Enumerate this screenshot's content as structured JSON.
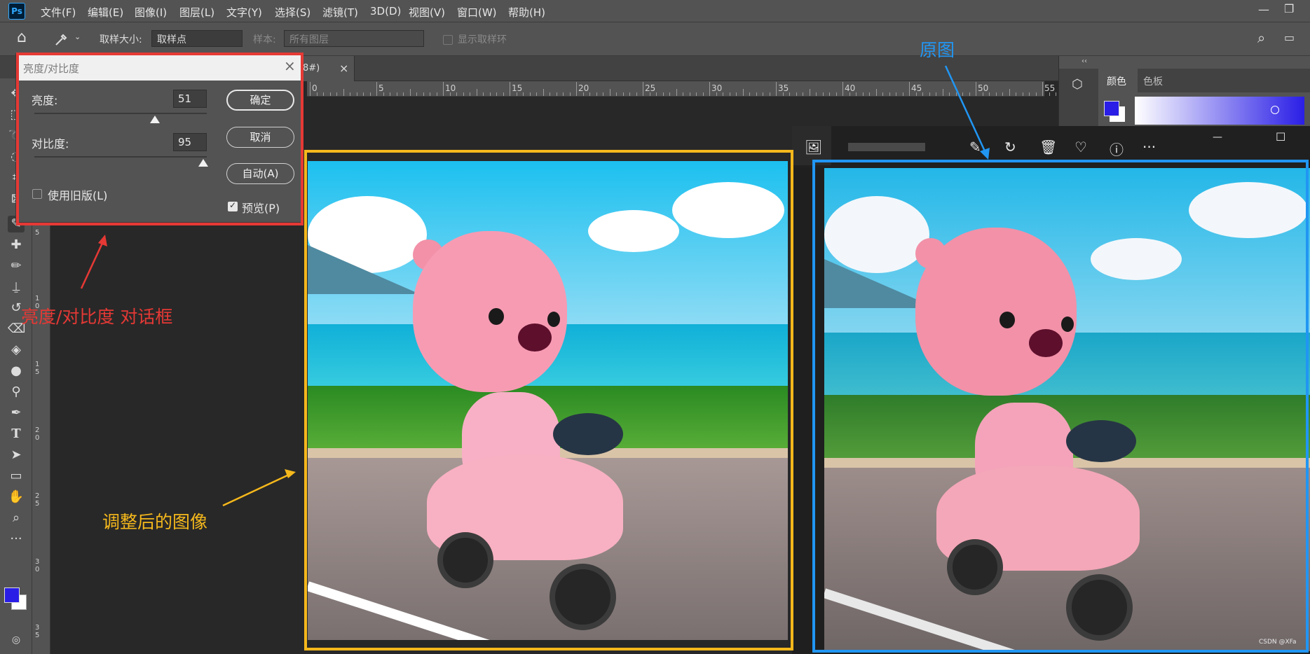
{
  "app": {
    "logo": "Ps"
  },
  "menu": [
    "文件(F)",
    "编辑(E)",
    "图像(I)",
    "图层(L)",
    "文字(Y)",
    "选择(S)",
    "滤镜(T)",
    "3D(D)",
    "视图(V)",
    "窗口(W)",
    "帮助(H)"
  ],
  "options": {
    "sample_size_label": "取样大小:",
    "sample_size_value": "取样点",
    "sample_label": "样本:",
    "sample_value": "所有图层",
    "show_ring_label": "显示取样环"
  },
  "doc_tab": {
    "title_fragment": "8#)",
    "close": "×"
  },
  "ruler_top": [
    "0",
    "5",
    "10",
    "15",
    "20",
    "25",
    "30",
    "35",
    "40",
    "45",
    "50",
    "55"
  ],
  "ruler_left": [
    [
      "5"
    ],
    [
      "1",
      "0"
    ],
    [
      "1",
      "5"
    ],
    [
      "2",
      "0"
    ],
    [
      "2",
      "5"
    ],
    [
      "3",
      "0"
    ],
    [
      "3",
      "5"
    ]
  ],
  "right_panel": {
    "tabs": [
      "颜色",
      "色板"
    ],
    "collapse": "‹‹"
  },
  "dialog": {
    "title": "亮度/对比度",
    "close": "×",
    "brightness_label": "亮度:",
    "brightness_value": "51",
    "brightness_fraction": 0.7,
    "contrast_label": "对比度:",
    "contrast_value": "95",
    "contrast_fraction": 0.98,
    "legacy_label": "使用旧版(L)",
    "legacy_checked": false,
    "preview_label": "预览(P)",
    "preview_checked": true,
    "ok_label": "确定",
    "cancel_label": "取消",
    "auto_label": "自动(A)"
  },
  "annotations": {
    "dialog_note": "亮度/对比度 对话框",
    "adjusted_note": "调整后的图像",
    "original_note": "原图",
    "colors": {
      "red": "#e53935",
      "orange": "#f5b81c",
      "blue": "#2196f3"
    }
  },
  "viewer": {
    "icons": [
      "image-icon",
      "edit-icon",
      "rotate-icon",
      "delete-icon",
      "favorite-icon",
      "info-icon",
      "more-icon"
    ],
    "more": "···",
    "minimize": "—",
    "maximize": "☐",
    "watermark": "CSDN @XFa"
  },
  "colors": {
    "foreground": "#2a1ee6",
    "background": "#ffffff"
  }
}
